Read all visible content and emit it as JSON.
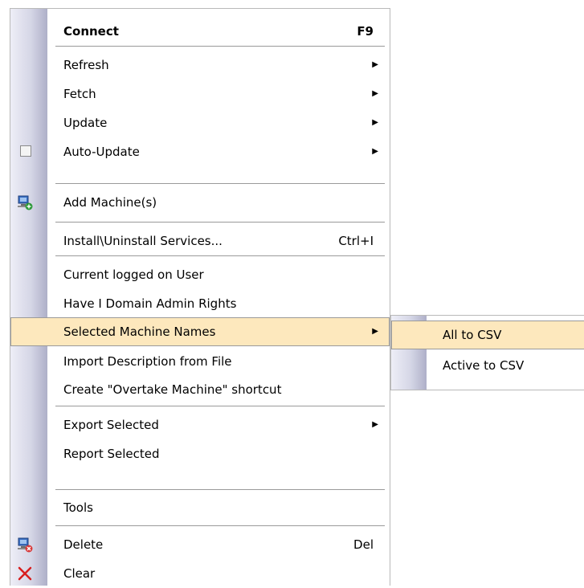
{
  "menu": {
    "items": [
      {
        "label": "Connect",
        "shortcut": "F9"
      },
      {
        "label": "Refresh"
      },
      {
        "label": "Fetch"
      },
      {
        "label": "Update"
      },
      {
        "label": "Auto-Update"
      },
      {
        "label": "Add Machine(s)",
        "icon": "add-machine-icon"
      },
      {
        "label": "Install\\Uninstall Services...",
        "shortcut": "Ctrl+I"
      },
      {
        "label": "Current logged on User"
      },
      {
        "label": "Have I Domain Admin Rights"
      },
      {
        "label": "Selected Machine Names"
      },
      {
        "label": "Import Description from File"
      },
      {
        "label": "Create \"Overtake Machine\" shortcut"
      },
      {
        "label": "Export Selected"
      },
      {
        "label": "Report Selected"
      },
      {
        "label": "Tools"
      },
      {
        "label": "Delete",
        "shortcut": "Del",
        "icon": "delete-machine-icon"
      },
      {
        "label": "Clear",
        "icon": "red-x-icon"
      }
    ]
  },
  "submenu": {
    "items": [
      {
        "label": "All to CSV"
      },
      {
        "label": "Active to CSV"
      }
    ]
  },
  "colors": {
    "highlight": "#fde8bd",
    "gutter_light": "#eeeef7",
    "gutter_dark": "#aeafc8"
  },
  "glyphs": {
    "arrow": "▶"
  }
}
